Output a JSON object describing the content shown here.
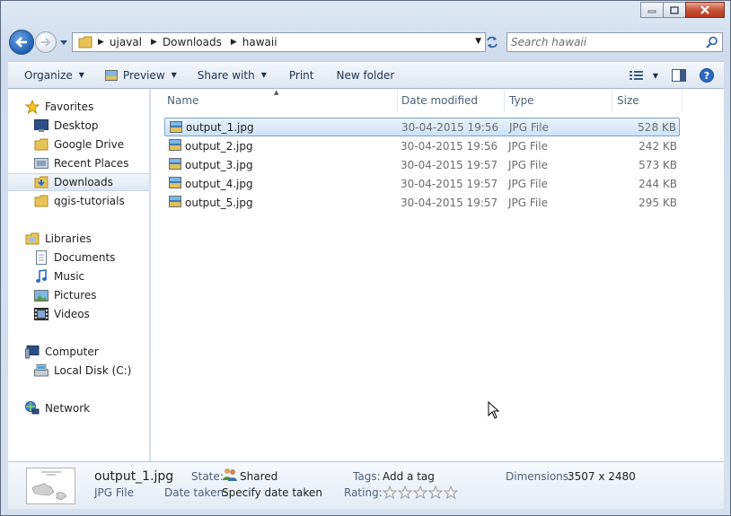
{
  "window": {
    "caption_buttons": [
      "minimize",
      "maximize",
      "close"
    ]
  },
  "address_bar": {
    "crumbs": [
      "ujaval",
      "Downloads",
      "hawaii"
    ]
  },
  "search": {
    "placeholder": "Search hawaii"
  },
  "toolbar": {
    "organize": "Organize",
    "preview": "Preview",
    "share_with": "Share with",
    "print": "Print",
    "new_folder": "New folder"
  },
  "sidebar": {
    "favorites": "Favorites",
    "favorites_items": [
      {
        "label": "Desktop",
        "icon": "desktop-icon"
      },
      {
        "label": "Google Drive",
        "icon": "folder-icon"
      },
      {
        "label": "Recent Places",
        "icon": "recent-places-icon"
      },
      {
        "label": "Downloads",
        "icon": "downloads-folder-icon",
        "selected": true
      },
      {
        "label": "qgis-tutorials",
        "icon": "folder-icon"
      }
    ],
    "libraries": "Libraries",
    "libraries_items": [
      {
        "label": "Documents",
        "icon": "documents-icon"
      },
      {
        "label": "Music",
        "icon": "music-icon"
      },
      {
        "label": "Pictures",
        "icon": "pictures-icon"
      },
      {
        "label": "Videos",
        "icon": "videos-icon"
      }
    ],
    "computer": "Computer",
    "computer_items": [
      {
        "label": "Local Disk (C:)",
        "icon": "local-disk-icon"
      }
    ],
    "network": "Network"
  },
  "columns": {
    "name": "Name",
    "date_modified": "Date modified",
    "type": "Type",
    "size": "Size"
  },
  "files": [
    {
      "name": "output_1.jpg",
      "date": "30-04-2015 19:56",
      "type": "JPG File",
      "size": "528 KB",
      "selected": true
    },
    {
      "name": "output_2.jpg",
      "date": "30-04-2015 19:56",
      "type": "JPG File",
      "size": "242 KB"
    },
    {
      "name": "output_3.jpg",
      "date": "30-04-2015 19:57",
      "type": "JPG File",
      "size": "573 KB"
    },
    {
      "name": "output_4.jpg",
      "date": "30-04-2015 19:57",
      "type": "JPG File",
      "size": "244 KB"
    },
    {
      "name": "output_5.jpg",
      "date": "30-04-2015 19:57",
      "type": "JPG File",
      "size": "295 KB"
    }
  ],
  "details": {
    "filename": "output_1.jpg",
    "filetype": "JPG File",
    "state_label": "State:",
    "state_value": "Shared",
    "date_taken_label": "Date taken:",
    "date_taken_value": "Specify date taken",
    "tags_label": "Tags:",
    "tags_value": "Add a tag",
    "rating_label": "Rating:",
    "rating_stars": 0,
    "rating_max": 5,
    "dimensions_label": "Dimensions:",
    "dimensions_value": "3507 x 2480"
  },
  "colors": {
    "selection_fill": "#cce2f8",
    "selection_border": "#7da2ce",
    "header_text": "#4c607a",
    "toolbar_text": "#1e3254"
  }
}
